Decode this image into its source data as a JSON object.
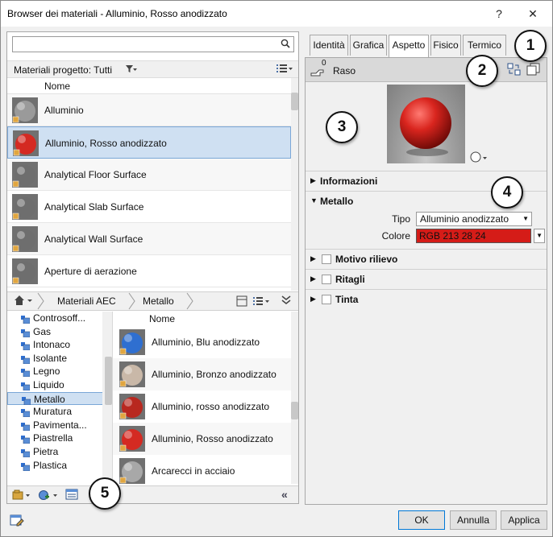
{
  "window": {
    "title": "Browser dei materiali - Alluminio, Rosso anodizzato",
    "help_label": "?",
    "close_label": "✕"
  },
  "left_panel": {
    "search": {
      "value": "",
      "icon": "search-icon"
    },
    "project_bar": {
      "label": "Materiali progetto: Tutti",
      "filter_icon": "filter-icon",
      "view_icon": "list-view-icon"
    },
    "list_header": "Nome",
    "materials": [
      {
        "name": "Alluminio",
        "color": "#9a9a9a"
      },
      {
        "name": "Alluminio, Rosso anodizzato",
        "color": "#d42a22",
        "selected": true
      },
      {
        "name": "Analytical Floor Surface",
        "color": "#6e6e6e"
      },
      {
        "name": "Analytical Slab Surface",
        "color": "#6e6e6e"
      },
      {
        "name": "Analytical Wall Surface",
        "color": "#6e6e6e"
      },
      {
        "name": "Aperture di aerazione",
        "color": "#6e6e6e"
      }
    ],
    "breadcrumb": {
      "home_icon": "home-icon",
      "items": [
        "Materiali AEC",
        "Metallo"
      ]
    },
    "tree": [
      "Controsoff...",
      "Gas",
      "Intonaco",
      "Isolante",
      "Legno",
      "Liquido",
      "Metallo",
      "Muratura",
      "Pavimenta...",
      "Piastrella",
      "Pietra",
      "Plastica"
    ],
    "tree_selected": "Metallo",
    "library_header": "Nome",
    "library_items": [
      {
        "name": "Alluminio, Blu anodizzato",
        "color": "#2f6fd0"
      },
      {
        "name": "Alluminio, Bronzo anodizzato",
        "color": "#c9b8a8"
      },
      {
        "name": "Alluminio, rosso anodizzato",
        "color": "#b8281f"
      },
      {
        "name": "Alluminio, Rosso anodizzato",
        "color": "#d42a22"
      },
      {
        "name": "Arcarecci in acciaio",
        "color": "#a8a8a8"
      }
    ],
    "collapse_label": "«"
  },
  "tabs": [
    "Identità",
    "Grafica",
    "Aspetto",
    "Fisico",
    "Termico"
  ],
  "active_tab": "Aspetto",
  "right_panel": {
    "asset_name": "Raso",
    "asset_users": "0",
    "sections": {
      "info": "Informazioni",
      "metal": "Metallo",
      "relief": "Motivo rilievo",
      "cutouts": "Ritagli",
      "tint": "Tinta"
    },
    "props": {
      "type_label": "Tipo",
      "type_value": "Alluminio anodizzato",
      "color_label": "Colore",
      "color_value": "RGB 213 28 24",
      "color_hex": "#d51c18"
    }
  },
  "callouts": [
    "1",
    "2",
    "3",
    "4",
    "5"
  ],
  "footer": {
    "ok": "OK",
    "cancel": "Annulla",
    "apply": "Applica"
  }
}
